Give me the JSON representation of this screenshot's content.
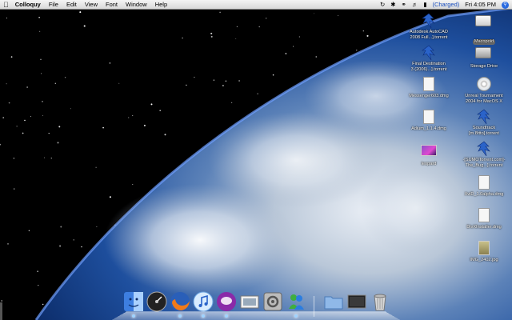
{
  "menubar": {
    "app_name": "Colloquy",
    "menus": [
      "File",
      "Edit",
      "View",
      "Font",
      "Window",
      "Help"
    ],
    "battery_status": "(Charged)",
    "clock": "Fri 4:05 PM"
  },
  "desktop_icons": [
    {
      "label_lines": [
        "Autodesk AutoCAD",
        "2008 Full...].torrent"
      ],
      "icon": "torrent-icon"
    },
    {
      "label_lines": [
        "Macopoid"
      ],
      "icon": "ipod-drive-icon"
    },
    {
      "label_lines": [
        "Final Destination",
        "3 (2006)...].torrent"
      ],
      "icon": "torrent-icon"
    },
    {
      "label_lines": [
        "Storage Drive"
      ],
      "icon": "hard-drive-icon"
    },
    {
      "label_lines": [
        "Messenger603.dmg"
      ],
      "icon": "dmg-document-icon"
    },
    {
      "label_lines": [
        "Unreal Tournament",
        "2004 for MacOS X"
      ],
      "icon": "disc-icon"
    },
    {
      "label_lines": [
        "Adium_1.1.4.dmg"
      ],
      "icon": "dmg-document-icon"
    },
    {
      "label_lines": [
        "Soundtrack",
        "[m.8ttto].torrent"
      ],
      "icon": "torrent-icon"
    },
    {
      "label_lines": [
        "leopard"
      ],
      "icon": "image-thumbnail-icon"
    },
    {
      "label_lines": [
        "-[SUMOTorrent.com]-",
        "The_Bug...].torrent"
      ],
      "icon": "torrent-icon"
    },
    {
      "label_lines": [
        "XviD_1.0alpha.dmg"
      ],
      "icon": "dmg-document-icon"
    },
    {
      "label_lines": [
        "DivXInstaller.dmg"
      ],
      "icon": "dmg-document-icon"
    },
    {
      "label_lines": [
        "IMG_2402.jpg"
      ],
      "icon": "jpg-image-icon"
    }
  ],
  "dock": {
    "items": [
      "finder-icon",
      "dashboard-icon",
      "firefox-icon",
      "itunes-icon",
      "colloquy-icon",
      "preview-icon",
      "system-preferences-icon",
      "msn-messenger-icon",
      "documents-folder-icon",
      "downloads-stack-icon",
      "trash-icon"
    ]
  },
  "colors": {
    "menubar": "#e6e6e6",
    "earth_blue": "#1c4ea0",
    "space": "#000000"
  }
}
